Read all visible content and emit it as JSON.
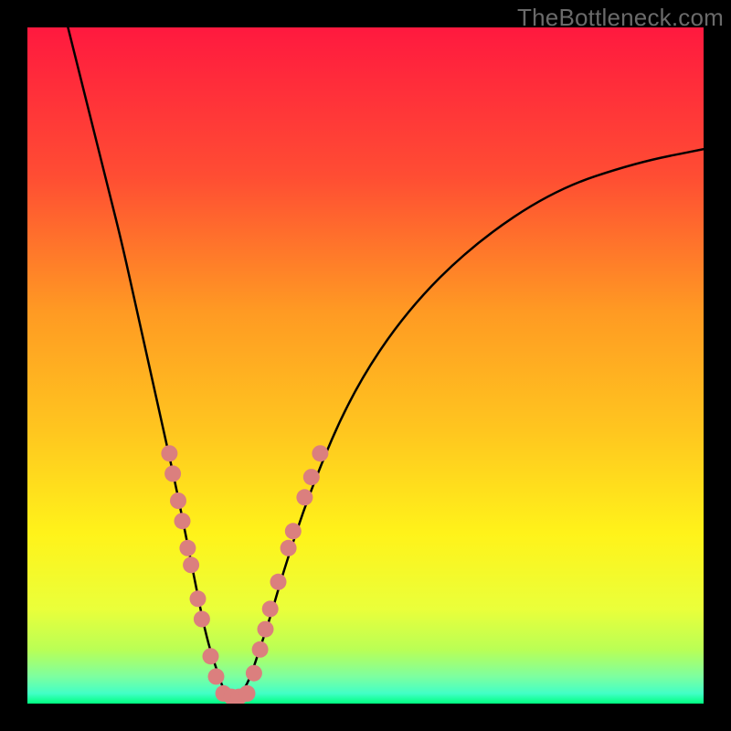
{
  "watermark": "TheBottleneck.com",
  "colors": {
    "frame": "#000000",
    "gradient_top": "#ff193f",
    "gradient_mid1": "#ff6a2f",
    "gradient_mid2": "#ffc71f",
    "gradient_mid3": "#fff31a",
    "gradient_low": "#e6ff4d",
    "gradient_green1": "#9bff66",
    "gradient_green2": "#4dffb3",
    "gradient_bottom": "#00ff80",
    "curve": "#000000",
    "dot": "#db7f7e"
  },
  "chart_data": {
    "type": "line",
    "title": "",
    "xlabel": "",
    "ylabel": "",
    "xlim": [
      0,
      100
    ],
    "ylim": [
      0,
      100
    ],
    "series": [
      {
        "name": "curve",
        "x": [
          6,
          8,
          10,
          12,
          14,
          16,
          18,
          20,
          22,
          24,
          25,
          26,
          27,
          28,
          29,
          30,
          31,
          32,
          33,
          34,
          36,
          38,
          42,
          48,
          56,
          66,
          78,
          90,
          100
        ],
        "y": [
          100,
          92,
          84,
          76,
          68,
          59,
          50,
          41,
          32,
          22,
          17,
          12,
          8,
          5,
          2,
          1,
          1,
          2,
          4,
          7,
          13,
          20,
          32,
          46,
          58,
          68,
          76,
          80,
          82
        ]
      }
    ],
    "dots": [
      {
        "x": 21.0,
        "y": 37
      },
      {
        "x": 21.5,
        "y": 34
      },
      {
        "x": 22.3,
        "y": 30
      },
      {
        "x": 22.9,
        "y": 27
      },
      {
        "x": 23.7,
        "y": 23
      },
      {
        "x": 24.2,
        "y": 20.5
      },
      {
        "x": 25.2,
        "y": 15.5
      },
      {
        "x": 25.8,
        "y": 12.5
      },
      {
        "x": 27.1,
        "y": 7
      },
      {
        "x": 27.9,
        "y": 4
      },
      {
        "x": 29.0,
        "y": 1.5
      },
      {
        "x": 30.2,
        "y": 1
      },
      {
        "x": 31.3,
        "y": 1
      },
      {
        "x": 32.5,
        "y": 1.5
      },
      {
        "x": 33.5,
        "y": 4.5
      },
      {
        "x": 34.4,
        "y": 8
      },
      {
        "x": 35.2,
        "y": 11
      },
      {
        "x": 35.9,
        "y": 14
      },
      {
        "x": 37.1,
        "y": 18
      },
      {
        "x": 38.6,
        "y": 23
      },
      {
        "x": 39.3,
        "y": 25.5
      },
      {
        "x": 41.0,
        "y": 30.5
      },
      {
        "x": 42.0,
        "y": 33.5
      },
      {
        "x": 43.3,
        "y": 37
      }
    ]
  }
}
